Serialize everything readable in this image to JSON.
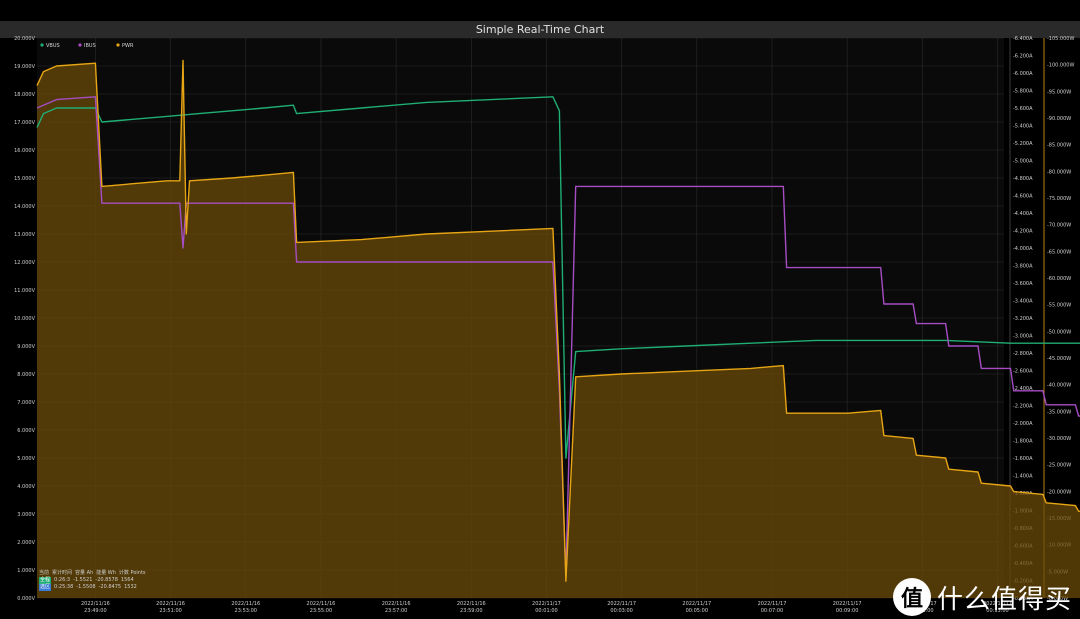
{
  "window": {
    "title": "Simple Real-Time Chart"
  },
  "colors": {
    "vbus": "#1fae74",
    "ibus": "#a64dc4",
    "pwr": "#e6a514",
    "pwr_fill": "#6a4a08",
    "bg": "#000000",
    "grid": "#2b2b2b"
  },
  "legend": [
    {
      "name": "VBUS",
      "color": "#1fae74"
    },
    {
      "name": "IBUS",
      "color": "#a64dc4"
    },
    {
      "name": "PWR",
      "color": "#e6a514"
    }
  ],
  "stats": {
    "header": [
      "当前",
      "累计时间",
      "容量 Ah",
      "能量 Wh",
      "计数 Points"
    ],
    "rows": [
      {
        "tag": "全程",
        "tag_color": "#1fae74",
        "values": [
          "0:26:3",
          "-1.5521",
          "-20.8578",
          "1564"
        ]
      },
      {
        "tag": "选区",
        "tag_color": "#3a7bd5",
        "values": [
          "0:25:38",
          "-1.5508",
          "-20.8475",
          "1532"
        ]
      }
    ]
  },
  "watermark": {
    "icon": "值",
    "text": "什么值得买"
  },
  "chart_data": {
    "type": "line",
    "title": "Simple Real-Time Chart",
    "x_ticks": [
      {
        "date": "2022/11/16",
        "time": "23:49:00"
      },
      {
        "date": "2022/11/16",
        "time": "23:51:00"
      },
      {
        "date": "2022/11/16",
        "time": "23:53:00"
      },
      {
        "date": "2022/11/16",
        "time": "23:55:00"
      },
      {
        "date": "2022/11/16",
        "time": "23:57:00"
      },
      {
        "date": "2022/11/16",
        "time": "23:59:00"
      },
      {
        "date": "2022/11/17",
        "time": "00:01:00"
      },
      {
        "date": "2022/11/17",
        "time": "00:03:00"
      },
      {
        "date": "2022/11/17",
        "time": "00:05:00"
      },
      {
        "date": "2022/11/17",
        "time": "00:07:00"
      },
      {
        "date": "2022/11/17",
        "time": "00:09:00"
      },
      {
        "date": "2022/11/17",
        "time": "00:11:00"
      },
      {
        "date": "2022/11/17",
        "time": "00:13:00"
      }
    ],
    "x_range_min": [
      -1.0,
      13.9
    ],
    "y_left": {
      "ticks": [
        "0.000V",
        "1.000V",
        "2.000V",
        "3.000V",
        "4.000V",
        "5.000V",
        "6.000V",
        "7.000V",
        "8.000V",
        "9.000V",
        "10.000V",
        "11.000V",
        "12.000V",
        "13.000V",
        "14.000V",
        "15.000V",
        "16.000V",
        "17.000V",
        "18.000V",
        "19.000V",
        "20.000V"
      ],
      "range": [
        0,
        20
      ]
    },
    "y_right1": {
      "ticks": [
        "-0.000A",
        "-0.200A",
        "-0.400A",
        "-0.600A",
        "-0.800A",
        "-1.000A",
        "-1.200A",
        "-1.400A",
        "-1.600A",
        "-1.800A",
        "-2.000A",
        "-2.200A",
        "-2.400A",
        "-2.600A",
        "-2.800A",
        "-3.000A",
        "-3.200A",
        "-3.400A",
        "-3.600A",
        "-3.800A",
        "-4.000A",
        "-4.200A",
        "-4.400A",
        "-4.600A",
        "-4.800A",
        "-5.000A",
        "-5.200A",
        "-5.400A",
        "-5.600A",
        "-5.800A",
        "-6.000A",
        "-6.200A",
        "-6.400A"
      ],
      "range": [
        0,
        6.4
      ]
    },
    "y_right2": {
      "ticks": [
        "-0.000W",
        "-5.000W",
        "-10.000W",
        "-15.000W",
        "-20.000W",
        "-25.000W",
        "-30.000W",
        "-35.000W",
        "-40.000W",
        "-45.000W",
        "-50.000W",
        "-55.000W",
        "-60.000W",
        "-65.000W",
        "-70.000W",
        "-75.000W",
        "-80.000W",
        "-85.000W",
        "-90.000W",
        "-95.000W",
        "-100.000W",
        "-105.000W"
      ],
      "range": [
        0,
        105
      ]
    },
    "series": [
      {
        "name": "VBUS",
        "axis": "V",
        "points": [
          [
            -1.0,
            16.8
          ],
          [
            -0.9,
            17.3
          ],
          [
            -0.7,
            17.5
          ],
          [
            -0.1,
            17.5
          ],
          [
            0.0,
            17.0
          ],
          [
            0.5,
            17.1
          ],
          [
            1.0,
            17.2
          ],
          [
            1.5,
            17.3
          ],
          [
            2.0,
            17.4
          ],
          [
            2.5,
            17.5
          ],
          [
            2.95,
            17.6
          ],
          [
            3.0,
            17.3
          ],
          [
            4.0,
            17.5
          ],
          [
            5.0,
            17.7
          ],
          [
            6.0,
            17.8
          ],
          [
            6.95,
            17.9
          ],
          [
            7.05,
            17.4
          ],
          [
            7.15,
            5.0
          ],
          [
            7.3,
            8.8
          ],
          [
            8.0,
            8.9
          ],
          [
            9.0,
            9.0
          ],
          [
            10.0,
            9.1
          ],
          [
            11.0,
            9.2
          ],
          [
            12.0,
            9.2
          ],
          [
            13.0,
            9.2
          ],
          [
            14.0,
            9.1
          ],
          [
            15.0,
            9.1
          ],
          [
            16.0,
            9.1
          ],
          [
            16.95,
            9.1
          ],
          [
            17.0,
            5.0
          ],
          [
            17.05,
            9.0
          ],
          [
            17.5,
            9.1
          ],
          [
            17.75,
            9.0
          ],
          [
            17.85,
            5.0
          ]
        ]
      },
      {
        "name": "IBUS",
        "axis": "A",
        "points": [
          [
            -1.0,
            17.5
          ],
          [
            -0.7,
            17.8
          ],
          [
            -0.1,
            17.9
          ],
          [
            0.0,
            14.1
          ],
          [
            0.5,
            14.1
          ],
          [
            1.0,
            14.1
          ],
          [
            1.2,
            14.1
          ],
          [
            1.25,
            12.5
          ],
          [
            1.3,
            14.1
          ],
          [
            2.0,
            14.1
          ],
          [
            2.95,
            14.1
          ],
          [
            3.0,
            12.0
          ],
          [
            4.0,
            12.0
          ],
          [
            5.0,
            12.0
          ],
          [
            6.0,
            12.0
          ],
          [
            6.95,
            12.0
          ],
          [
            7.05,
            7.4
          ],
          [
            7.15,
            0.8
          ],
          [
            7.3,
            14.7
          ],
          [
            8.0,
            14.7
          ],
          [
            9.0,
            14.7
          ],
          [
            10.0,
            14.7
          ],
          [
            10.5,
            14.7
          ],
          [
            10.55,
            11.8
          ],
          [
            11.5,
            11.8
          ],
          [
            12.0,
            11.8
          ],
          [
            12.05,
            10.5
          ],
          [
            12.5,
            10.5
          ],
          [
            12.55,
            9.8
          ],
          [
            13.0,
            9.8
          ],
          [
            13.05,
            9.0
          ],
          [
            13.5,
            9.0
          ],
          [
            13.55,
            8.2
          ],
          [
            14.0,
            8.2
          ],
          [
            14.05,
            7.4
          ],
          [
            14.5,
            7.4
          ],
          [
            14.55,
            6.9
          ],
          [
            15.0,
            6.9
          ],
          [
            15.05,
            6.5
          ],
          [
            15.5,
            6.5
          ],
          [
            15.55,
            5.8
          ],
          [
            16.0,
            5.8
          ],
          [
            16.05,
            5.3
          ],
          [
            16.5,
            5.3
          ],
          [
            16.55,
            4.9
          ],
          [
            16.95,
            4.6
          ],
          [
            17.0,
            3.6
          ],
          [
            17.05,
            5.3
          ],
          [
            17.5,
            5.0
          ],
          [
            17.75,
            4.6
          ],
          [
            17.85,
            0.5
          ]
        ]
      },
      {
        "name": "PWR",
        "axis": "W",
        "points": [
          [
            -1.0,
            18.3
          ],
          [
            -0.9,
            18.8
          ],
          [
            -0.7,
            19.0
          ],
          [
            -0.1,
            19.1
          ],
          [
            0.0,
            14.7
          ],
          [
            0.5,
            14.8
          ],
          [
            1.0,
            14.9
          ],
          [
            1.2,
            14.9
          ],
          [
            1.25,
            19.2
          ],
          [
            1.3,
            13.0
          ],
          [
            1.35,
            14.9
          ],
          [
            2.0,
            15.0
          ],
          [
            2.5,
            15.1
          ],
          [
            2.95,
            15.2
          ],
          [
            3.0,
            12.7
          ],
          [
            4.0,
            12.8
          ],
          [
            5.0,
            13.0
          ],
          [
            6.0,
            13.1
          ],
          [
            6.95,
            13.2
          ],
          [
            7.05,
            8.0
          ],
          [
            7.15,
            0.6
          ],
          [
            7.3,
            7.9
          ],
          [
            8.0,
            8.0
          ],
          [
            9.0,
            8.1
          ],
          [
            10.0,
            8.2
          ],
          [
            10.5,
            8.3
          ],
          [
            10.55,
            6.6
          ],
          [
            11.0,
            6.6
          ],
          [
            11.5,
            6.6
          ],
          [
            12.0,
            6.7
          ],
          [
            12.05,
            5.8
          ],
          [
            12.5,
            5.7
          ],
          [
            12.55,
            5.1
          ],
          [
            13.0,
            5.0
          ],
          [
            13.05,
            4.6
          ],
          [
            13.5,
            4.5
          ],
          [
            13.55,
            4.1
          ],
          [
            14.0,
            4.0
          ],
          [
            14.05,
            3.8
          ],
          [
            14.5,
            3.7
          ],
          [
            14.55,
            3.4
          ],
          [
            15.0,
            3.3
          ],
          [
            15.05,
            3.1
          ],
          [
            15.5,
            3.0
          ],
          [
            15.55,
            2.8
          ],
          [
            16.0,
            2.8
          ],
          [
            16.05,
            2.6
          ],
          [
            16.5,
            2.5
          ],
          [
            16.95,
            2.3
          ],
          [
            17.0,
            0.9
          ],
          [
            17.05,
            3.0
          ],
          [
            17.5,
            2.7
          ],
          [
            17.75,
            2.6
          ],
          [
            17.85,
            0.2
          ]
        ]
      }
    ],
    "grid": true,
    "legend_position": "top-left"
  }
}
